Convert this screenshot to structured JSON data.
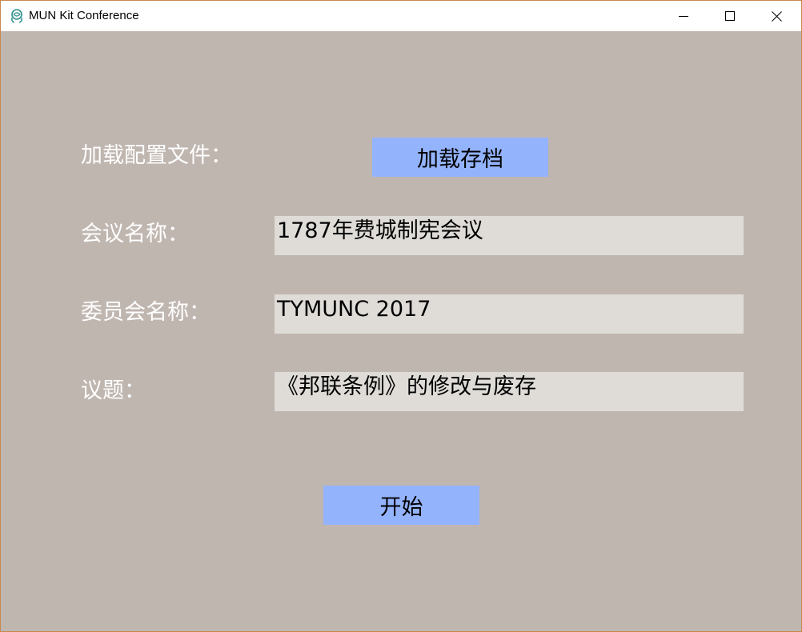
{
  "window": {
    "title": "MUN Kit Conference",
    "icon": "mun-logo-icon",
    "controls": {
      "minimize": "minimize-icon",
      "maximize": "maximize-icon",
      "close": "close-icon"
    }
  },
  "form": {
    "load_config_label": "加载配置文件：",
    "load_button_label": "加载存档",
    "conference_name_label": "会议名称：",
    "conference_name_value": "1787年费城制宪会议",
    "committee_name_label": "委员会名称：",
    "committee_name_value": "TYMUNC 2017",
    "topic_label": "议题：",
    "topic_value": "《邦联条例》的修改与废存",
    "start_button_label": "开始"
  },
  "colors": {
    "background": "#c0b6b0",
    "button": "#94b3fd",
    "field": "#dfdcd8",
    "label_text": "#ffffff"
  }
}
